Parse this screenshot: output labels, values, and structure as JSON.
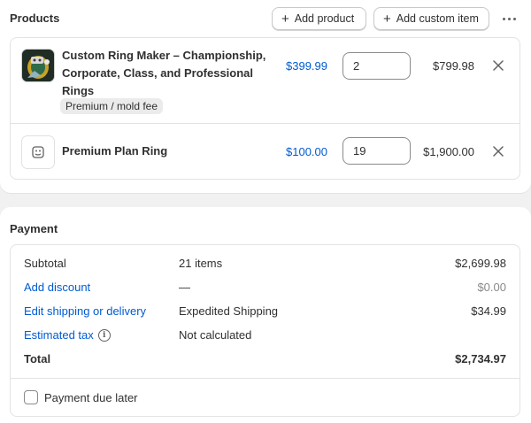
{
  "products": {
    "title": "Products",
    "add_product_label": "Add product",
    "add_custom_item_label": "Add custom item",
    "items": [
      {
        "name": "Custom Ring Maker – Championship, Corporate, Class, and Professional Rings",
        "variant": "Premium / mold fee",
        "price": "$399.99",
        "quantity": "2",
        "line_total": "$799.98",
        "thumbnail": "ring-product-image"
      },
      {
        "name": "Premium Plan Ring",
        "price": "$100.00",
        "quantity": "19",
        "line_total": "$1,900.00",
        "thumbnail": "image-placeholder-icon"
      }
    ]
  },
  "payment": {
    "title": "Payment",
    "rows": [
      {
        "label": "Subtotal",
        "description": "21 items",
        "amount": "$2,699.98"
      },
      {
        "label": "Add discount",
        "description": "—",
        "amount": "$0.00"
      },
      {
        "label": "Edit shipping or delivery",
        "description": "Expedited Shipping",
        "amount": "$34.99"
      },
      {
        "label": "Estimated tax",
        "description": "Not calculated",
        "amount": ""
      },
      {
        "label": "Total",
        "description": "",
        "amount": "$2,734.97"
      }
    ],
    "payment_due_later_label": "Payment due later",
    "payment_due_later_checked": false
  },
  "colors": {
    "link": "#005bd3",
    "text": "#303030",
    "muted": "#8a8a8a",
    "background": "#f1f1f1",
    "card": "#ffffff"
  }
}
